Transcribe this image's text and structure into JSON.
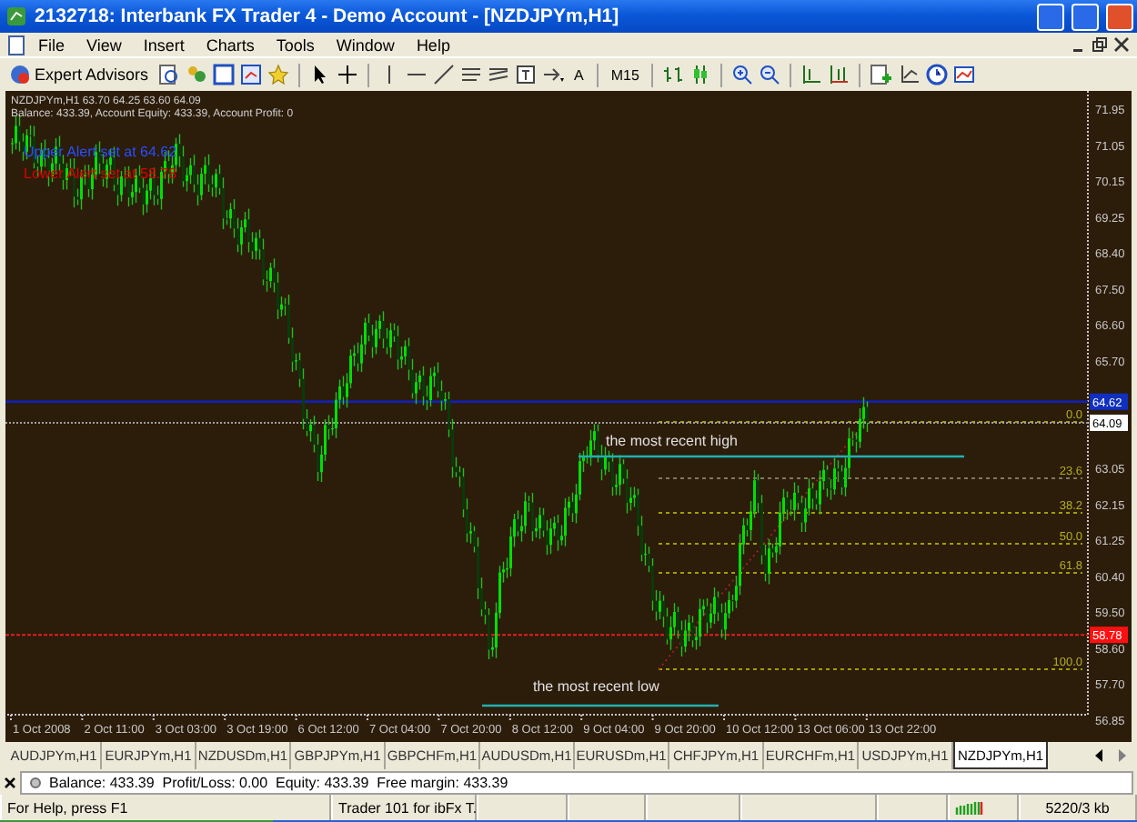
{
  "window": {
    "title": "2132718: Interbank FX Trader 4 - Demo Account - [NZDJPYm,H1]"
  },
  "menu": [
    "File",
    "View",
    "Insert",
    "Charts",
    "Tools",
    "Window",
    "Help"
  ],
  "toolbar": {
    "expert_advisors": "Expert Advisors",
    "text_tool": "A",
    "timeframe": "M15"
  },
  "chart": {
    "header": "NZDJPYm,H1  63.70 64.25 63.60 64.09",
    "account": "Balance: 433.39, Account Equity: 433.39, Account Profit: 0",
    "alerts": [
      {
        "text": "Upper Alert set at 64.62",
        "color": "#2850ff"
      },
      {
        "text": "Lower Alert set at 58.78",
        "color": "#e00000"
      }
    ],
    "price_axis": [
      "71.95",
      "71.05",
      "70.15",
      "69.25",
      "68.40",
      "67.50",
      "66.60",
      "65.70",
      "63.05",
      "62.15",
      "61.25",
      "60.40",
      "59.50",
      "58.60",
      "57.70",
      "56.85"
    ],
    "price_tags": [
      {
        "text": "64.62",
        "kind": "alert"
      },
      {
        "text": "64.09",
        "kind": "bid"
      },
      {
        "text": "58.78",
        "kind": "stop"
      }
    ],
    "fibonacci_levels": [
      "0.0",
      "23.6",
      "38.2",
      "50.0",
      "61.8",
      "100.0"
    ],
    "annotations": [
      {
        "text": "the most recent high",
        "kind": "high"
      },
      {
        "text": "the most recent low",
        "kind": "low"
      }
    ],
    "time_axis": [
      "1 Oct 2008",
      "2 Oct 11:00",
      "3 Oct 03:00",
      "3 Oct 19:00",
      "6 Oct 12:00",
      "7 Oct 04:00",
      "7 Oct 20:00",
      "8 Oct 12:00",
      "9 Oct 04:00",
      "9 Oct 20:00",
      "10 Oct 12:00",
      "13 Oct 06:00",
      "13 Oct 22:00"
    ]
  },
  "tabs": [
    {
      "label": "AUDJPYm,H1",
      "selected": false
    },
    {
      "label": "EURJPYm,H1",
      "selected": false
    },
    {
      "label": "NZDUSDm,H1",
      "selected": false
    },
    {
      "label": "GBPJPYm,H1",
      "selected": false
    },
    {
      "label": "GBPCHFm,H1",
      "selected": false
    },
    {
      "label": "AUDUSDm,H1",
      "selected": false
    },
    {
      "label": "EURUSDm,H1",
      "selected": false
    },
    {
      "label": "CHFJPYm,H1",
      "selected": false
    },
    {
      "label": "EURCHFm,H1",
      "selected": false
    },
    {
      "label": "USDJPYm,H1",
      "selected": false
    },
    {
      "label": "NZDJPYm,H1",
      "selected": true
    }
  ],
  "terminal": {
    "text": "Balance: 433.39  Profit/Loss: 0.00  Equity: 433.39  Free margin: 433.39"
  },
  "status_bar": [
    "For Help, press F1",
    "Trader 101 for ibFx T.",
    "5220/3 kb"
  ]
}
